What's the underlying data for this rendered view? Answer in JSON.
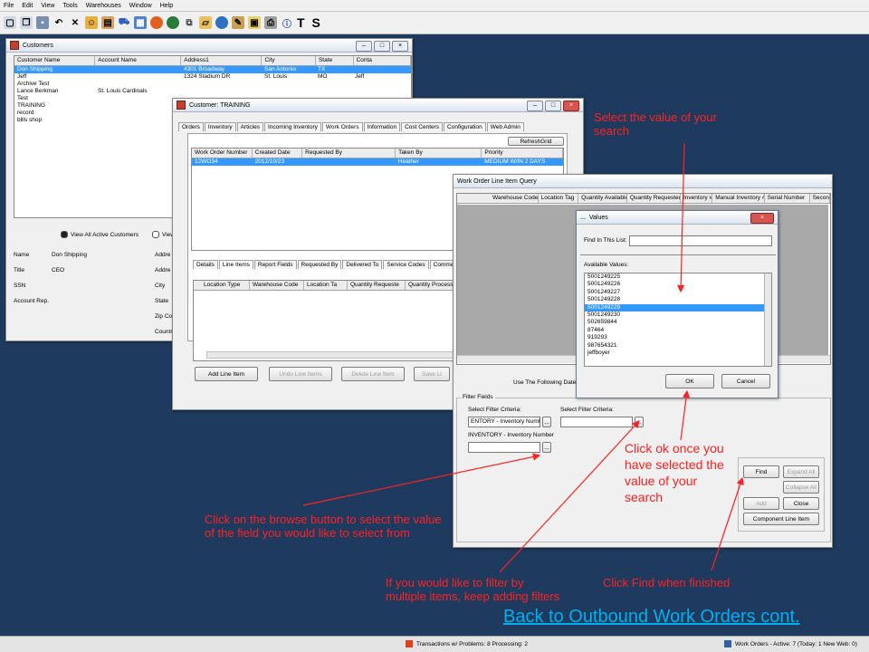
{
  "menu": [
    "File",
    "Edit",
    "View",
    "Tools",
    "Warehouses",
    "Window",
    "Help"
  ],
  "toolbar": {
    "text": "T S"
  },
  "customers_window": {
    "title": "Customers",
    "columns": [
      "Customer Name",
      "Account Name",
      "Address1",
      "City",
      "State",
      "Conta"
    ],
    "rows": [
      [
        "Don Shipping",
        "",
        "4301 Broadway",
        "San Antonio",
        "TX",
        ""
      ],
      [
        "Jeff",
        "",
        "1324 Stadium DR",
        "St. Louis",
        "MO",
        "Jeff"
      ],
      [
        "Archive Test",
        "",
        "",
        "",
        "",
        ""
      ],
      [
        "Lance Berkman",
        "St. Louis Cardinals",
        "",
        "",
        "",
        ""
      ],
      [
        "Test",
        "",
        "",
        "",
        "",
        ""
      ],
      [
        "TRAINING",
        "",
        "",
        "",
        "",
        ""
      ],
      [
        "record",
        "",
        "",
        "",
        "",
        ""
      ],
      [
        "bills shop",
        "",
        "",
        "",
        "",
        ""
      ]
    ],
    "radio1": "View All Active Customers",
    "radio2": "View",
    "details": [
      {
        "label": "Name",
        "value": "Don Shipping"
      },
      {
        "label": "Title",
        "value": "CEO"
      },
      {
        "label": "SSN",
        "value": ""
      },
      {
        "label": "Account Rep.",
        "value": ""
      }
    ],
    "right_labels": [
      "Addre",
      "Addre",
      "City",
      "State",
      "Zip Co",
      "Countr"
    ]
  },
  "customer_window": {
    "title": "Customer: TRAINING",
    "tabs": [
      "Orders",
      "Inventory",
      "Articles",
      "Incoming Inventory",
      "Work Orders",
      "Information",
      "Cost Centers",
      "Configuration",
      "Web Admin"
    ],
    "refresh": "RefreshGrid",
    "columns": [
      "Work Order Number",
      "Created Date",
      "Requested By",
      "Taken By",
      "Priority"
    ],
    "row": [
      "12WO34",
      "2012/10/23",
      "",
      "Heather",
      "MEDIUM W/IN 2 DAYS"
    ],
    "subtabs": [
      "Details",
      "Line Items",
      "Report Fields",
      "Requested By",
      "Delivered To",
      "Service Codes",
      "Comments/Ins"
    ],
    "line_columns": [
      "Location Type",
      "Warehouse Code",
      "Location Ta",
      "Quantity Requeste",
      "Quantity Processe",
      "S"
    ],
    "buttons": [
      "Add Line Item",
      "Undo Line Items",
      "Delete Line Item",
      "Save Li"
    ]
  },
  "query_window": {
    "title": "Work Order Line Item Query",
    "columns": [
      "Warehouse Code",
      "Location Tag",
      "Quantity Available",
      "Quantity Requested",
      "Inventory #",
      "Manual Inventory #",
      "Serial Number",
      "Secon"
    ],
    "date_text": "Use The Following Date S",
    "filter_title": "Filter Fields",
    "criteria1_label": "Select Filter Criteria:",
    "criteria1_value": "ENTORY - Inventory Number",
    "criteria2_label": "Select Filter Criteria:",
    "inventory_label": "INVENTORY - Inventory Number",
    "browse": "...",
    "btn_find": "Find",
    "btn_expand": "Expand All",
    "btn_collapse": "Collapse All",
    "btn_add": "Add",
    "btn_close": "Close",
    "btn_component": "Component Line Item"
  },
  "values_dialog": {
    "title": "Values",
    "find_label": "Find In This List:",
    "available_label": "Available Values:",
    "items": [
      "5001249225",
      "5001249226",
      "5001249227",
      "5001249228",
      "5001249229",
      "5001249230",
      "502659844",
      "87464",
      "919293",
      "987654321",
      "jeffboyer"
    ],
    "selected_index": 4,
    "ok": "OK",
    "cancel": "Cancel"
  },
  "annotations": {
    "select_value": "Select the value of your search",
    "click_ok": "Click ok once you have selected the value of your search",
    "browse_hint": "Click on the browse button to select the value of the field you would like to select from",
    "multiple_filter": "If you would like to filter by multiple items, keep adding filters",
    "click_find": "Click Find when finished"
  },
  "link": "Back to Outbound Work Orders cont.",
  "status": {
    "transactions": "Transactions w/ Problems: 8  Processing: 2",
    "work_orders": "Work Orders - Active: 7 (Today: 1  New Web: 0)"
  },
  "colors": {
    "annotation": "#ff2020",
    "link": "#00b0f0",
    "desktop": "#1f3a5f",
    "selection": "#3399ff"
  }
}
